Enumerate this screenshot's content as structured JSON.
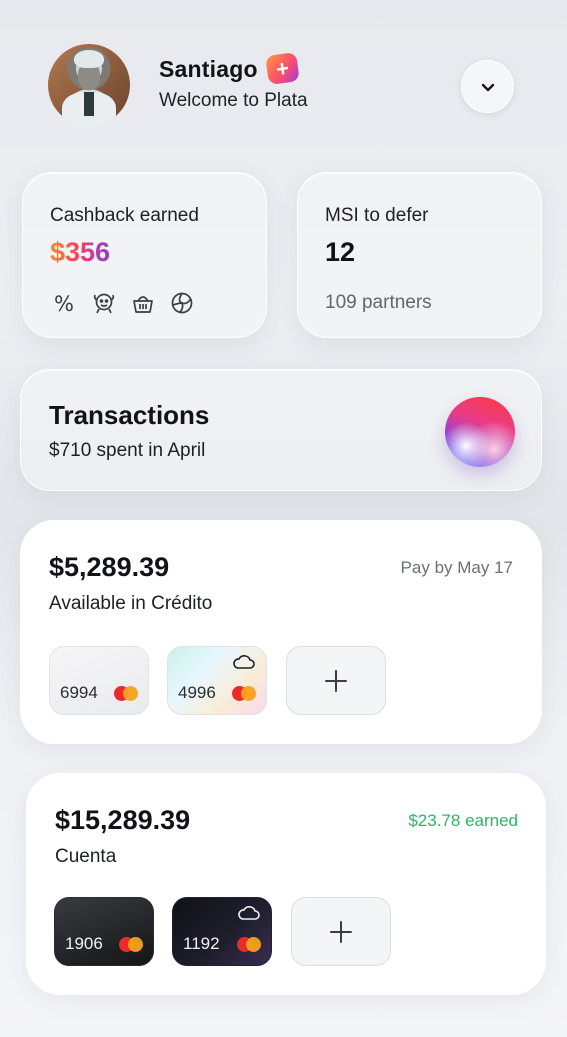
{
  "header": {
    "name": "Santiago",
    "badge": "+",
    "welcome": "Welcome to Plata"
  },
  "cashback": {
    "title": "Cashback earned",
    "amount": "$356",
    "icons": [
      "percent-icon",
      "face-icon",
      "basket-icon",
      "ball-icon"
    ]
  },
  "msi": {
    "title": "MSI to defer",
    "value": "12",
    "partners": "109 partners"
  },
  "transactions": {
    "title": "Transactions",
    "subtitle": "$710 spent in April"
  },
  "credit": {
    "amount": "$5,289.39",
    "label": "Available in Crédito",
    "pay_by": "Pay by May 17",
    "cards": [
      {
        "last4": "6994",
        "style": "light",
        "cloud": false
      },
      {
        "last4": "4996",
        "style": "holo",
        "cloud": true
      }
    ]
  },
  "cuenta": {
    "amount": "$15,289.39",
    "label": "Cuenta",
    "earned": "$23.78 earned",
    "cards": [
      {
        "last4": "1906",
        "style": "dark",
        "cloud": false
      },
      {
        "last4": "1192",
        "style": "night",
        "cloud": true
      }
    ]
  },
  "colors": {
    "accent_gradient": [
      "#ff8a1f",
      "#ff3f5a",
      "#8b3dd6"
    ],
    "earned_green": "#2fb565",
    "mastercard_red": "#eb2a2a",
    "mastercard_yellow": "#f7a21b"
  }
}
